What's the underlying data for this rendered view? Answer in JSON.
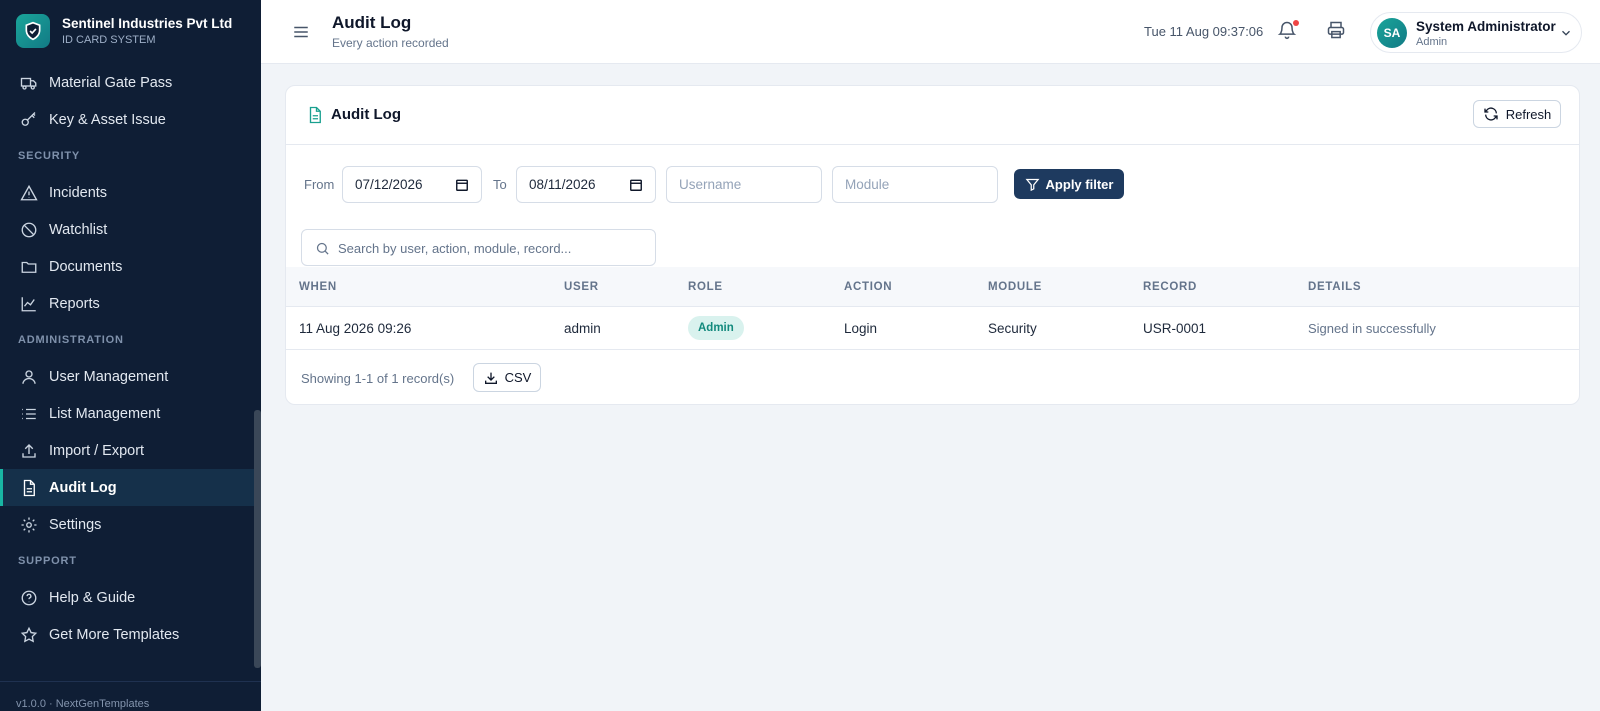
{
  "brand": {
    "name": "Sentinel Industries Pvt Ltd",
    "subtitle": "ID CARD SYSTEM"
  },
  "sidebar": {
    "items_top": [
      {
        "label": "Material Gate Pass",
        "icon": "truck-icon"
      },
      {
        "label": "Key & Asset Issue",
        "icon": "key-icon"
      }
    ],
    "section_security": "SECURITY",
    "items_security": [
      {
        "label": "Incidents",
        "icon": "alert-triangle-icon"
      },
      {
        "label": "Watchlist",
        "icon": "ban-icon"
      },
      {
        "label": "Documents",
        "icon": "folder-icon"
      },
      {
        "label": "Reports",
        "icon": "chart-line-icon"
      }
    ],
    "section_admin": "ADMINISTRATION",
    "items_admin": [
      {
        "label": "User Management",
        "icon": "user-icon"
      },
      {
        "label": "List Management",
        "icon": "list-icon"
      },
      {
        "label": "Import / Export",
        "icon": "upload-icon"
      },
      {
        "label": "Audit Log",
        "icon": "file-text-icon",
        "active": true
      },
      {
        "label": "Settings",
        "icon": "gear-icon"
      }
    ],
    "section_support": "SUPPORT",
    "items_support": [
      {
        "label": "Help & Guide",
        "icon": "help-circle-icon"
      },
      {
        "label": "Get More Templates",
        "icon": "star-icon"
      }
    ],
    "version": "v1.0.0 · NextGenTemplates"
  },
  "header": {
    "title": "Audit Log",
    "subtitle": "Every action recorded",
    "clock": "Tue 11 Aug 09:37:06",
    "user": {
      "initials": "SA",
      "name": "System Administrator",
      "role": "Admin"
    }
  },
  "card": {
    "title": "Audit Log",
    "refresh_label": "Refresh",
    "filters": {
      "from_label": "From",
      "from_value": "07/12/2026",
      "to_label": "To",
      "to_value": "08/11/2026",
      "username_placeholder": "Username",
      "module_placeholder": "Module",
      "apply_label": "Apply filter"
    },
    "search_placeholder": "Search by user, action, module, record...",
    "columns": [
      "WHEN",
      "USER",
      "ROLE",
      "ACTION",
      "MODULE",
      "RECORD",
      "DETAILS"
    ],
    "rows": [
      {
        "when": "11 Aug 2026 09:26",
        "user": "admin",
        "role": "Admin",
        "action": "Login",
        "module": "Security",
        "record": "USR-0001",
        "details": "Signed in successfully"
      }
    ],
    "showing": "Showing 1-1 of 1 record(s)",
    "csv_label": "CSV"
  },
  "colors": {
    "sidebar_bg": "#0f1e35",
    "accent": "#19b6a4",
    "primary_button": "#1e3a5f",
    "page_bg": "#f1f4f8"
  }
}
